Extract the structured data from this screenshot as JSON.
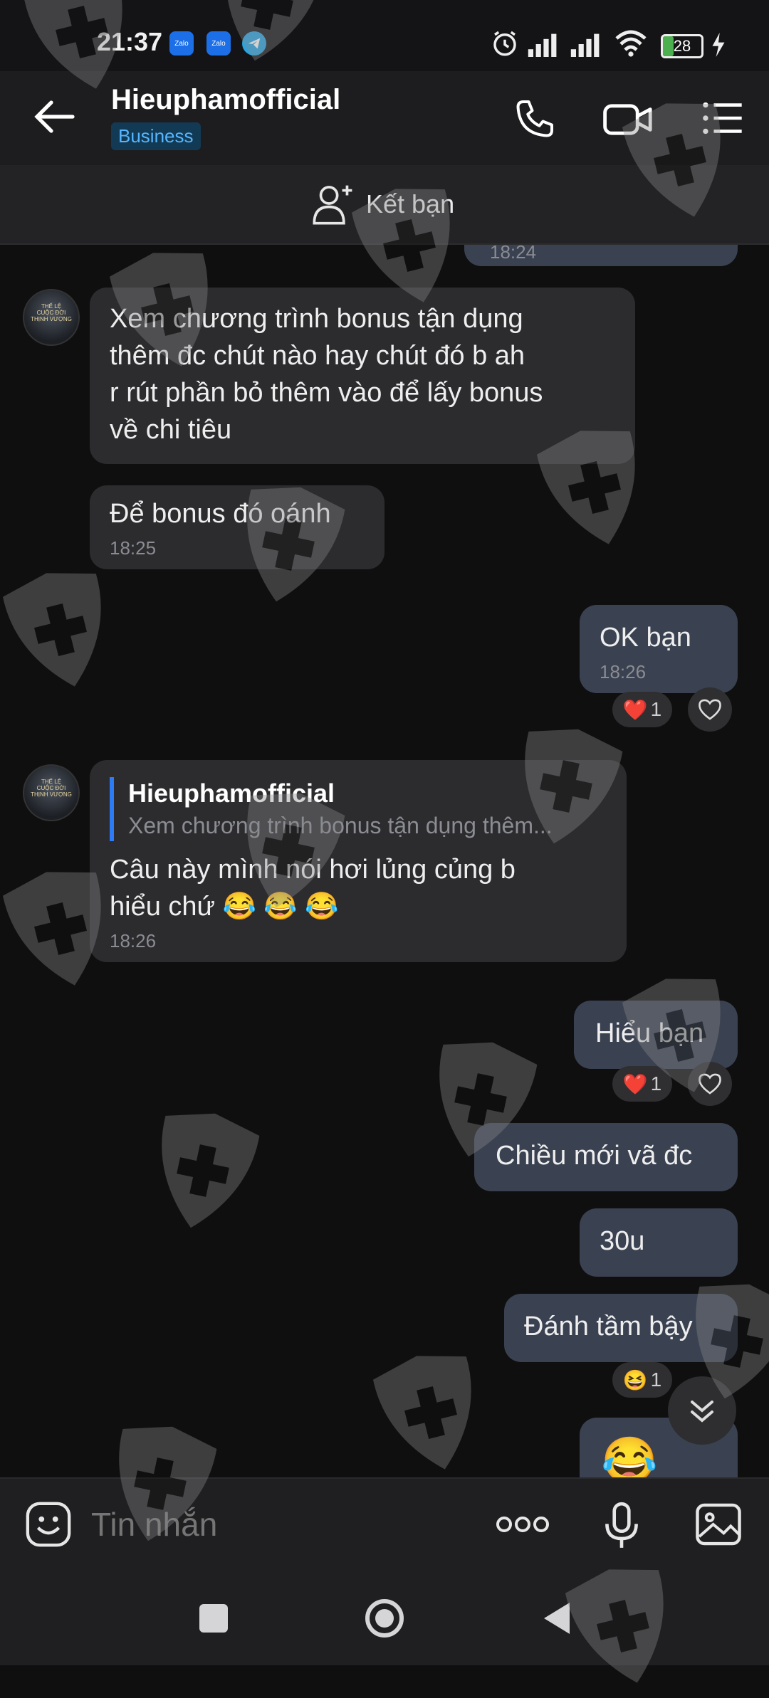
{
  "status_bar": {
    "time": "21:37",
    "app_icons": [
      "Zalo",
      "Zalo",
      "telegram-icon"
    ],
    "battery": "28",
    "battery_level": 0.28
  },
  "header": {
    "name": "Hieuphamofficial",
    "badge": "Business"
  },
  "add_friend": {
    "label": "Kết bạn"
  },
  "messages": [
    {
      "dir": "out",
      "text": "",
      "time": "18:24",
      "partial": true
    },
    {
      "dir": "in",
      "text": "Xem chương trình bonus tận dụng\nthêm đc chút nào hay chút đó b ah\nr rút phần bỏ thêm vào để lấy bonus\nvề chi tiêu"
    },
    {
      "dir": "in",
      "text": "Để bonus đó oánh",
      "time": "18:25"
    },
    {
      "dir": "out",
      "text": "OK bạn",
      "time": "18:26",
      "reaction": {
        "emoji": "❤️",
        "count": "1"
      }
    },
    {
      "dir": "in",
      "quote": {
        "name": "Hieuphamofficial",
        "text": "Xem chương trình bonus tận dụng thêm..."
      },
      "text": "Câu này mình nói hơi lủng củng b\nhiểu chứ 😂 😂 😂",
      "time": "18:26"
    },
    {
      "dir": "out",
      "text": "Hiểu bạn",
      "reaction": {
        "emoji": "❤️",
        "count": "1"
      }
    },
    {
      "dir": "out",
      "text": "Chiều mới vã đc"
    },
    {
      "dir": "out",
      "text": "30u"
    },
    {
      "dir": "out",
      "text": "Đánh tầm bậy",
      "reaction": {
        "emoji": "😆",
        "count": "1"
      }
    },
    {
      "dir": "out",
      "text": "😂",
      "partial": true
    }
  ],
  "composer": {
    "placeholder": "Tin nhắn"
  },
  "colors": {
    "background": "#0f0f10",
    "incoming_bubble": "#2c2c2e",
    "outgoing_bubble": "#3a4150",
    "accent": "#2d7cf6",
    "badge_text": "#55b6ff"
  },
  "icons": [
    "back-arrow-icon",
    "phone-icon",
    "video-call-icon",
    "menu-list-icon",
    "add-friend-icon",
    "sticker-icon",
    "more-icon",
    "microphone-icon",
    "image-icon",
    "scroll-down-icon",
    "nav-square-icon",
    "nav-home-icon",
    "nav-back-icon",
    "alarm-icon",
    "signal-icon",
    "wifi-icon",
    "shield-watermark-icon"
  ]
}
